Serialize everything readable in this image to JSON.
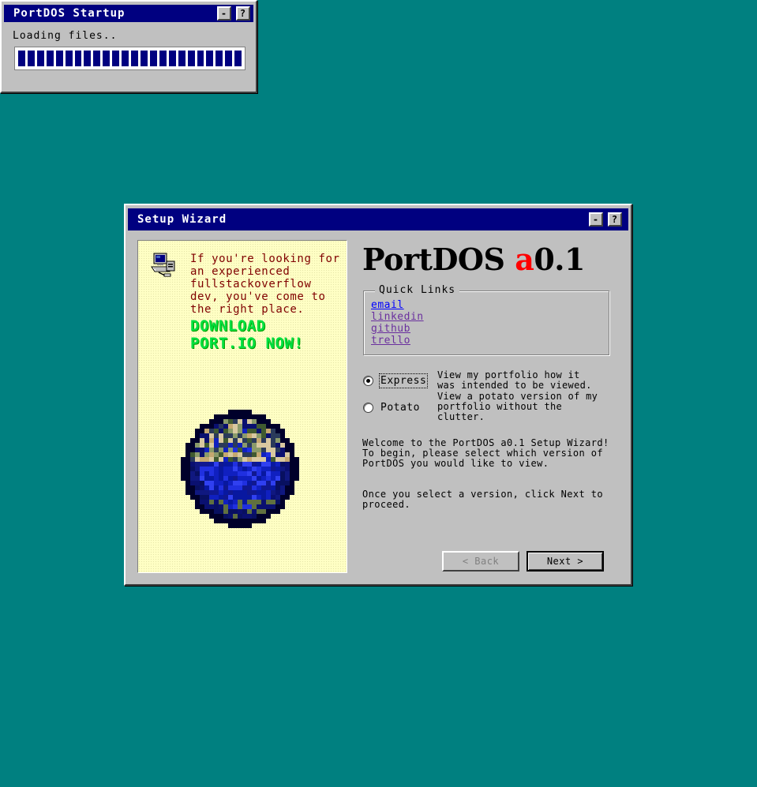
{
  "startup": {
    "title": "PortDOS Startup",
    "minimize_label": "-",
    "help_label": "?",
    "loading_text": "Loading files..",
    "progress": 1.0
  },
  "wizard": {
    "title": "Setup Wizard",
    "minimize_label": "-",
    "help_label": "?",
    "panel": {
      "intro": "If you're looking for an experienced fullstackoverflow dev, you've come to the right place.",
      "cta": "DOWNLOAD PORT.IO NOW!"
    },
    "product": {
      "name": "PortDOS",
      "version_prefix": "a",
      "version_number": "0.1"
    },
    "quick_links": {
      "legend": "Quick Links",
      "items": [
        {
          "label": "email",
          "state": "unvisited"
        },
        {
          "label": "linkedin",
          "state": "visited"
        },
        {
          "label": "github",
          "state": "visited"
        },
        {
          "label": "trello",
          "state": "visited"
        }
      ]
    },
    "options": [
      {
        "label": "Express",
        "description": "View my portfolio how it was intended to be viewed.",
        "selected": true
      },
      {
        "label": "Potato",
        "description": "View a potato version of my portfolio without the clutter.",
        "selected": false
      }
    ],
    "welcome_text": "Welcome to the PortDOS a0.1 Setup Wizard! To begin, please select which version of PortDOS you would like to view.",
    "instruction_text": "Once you select a version, click Next to proceed.",
    "back_label": "< Back",
    "next_label": "Next >"
  },
  "icons": [
    "computer-icon",
    "globe-icon"
  ],
  "colors": {
    "desktop": "#008080",
    "titlebar": "#000080",
    "window": "#c0c0c0",
    "panel_bg": "#ffffc4",
    "panel_text": "#800000",
    "cta_text": "#00e040",
    "version_accent": "#ff0000"
  }
}
